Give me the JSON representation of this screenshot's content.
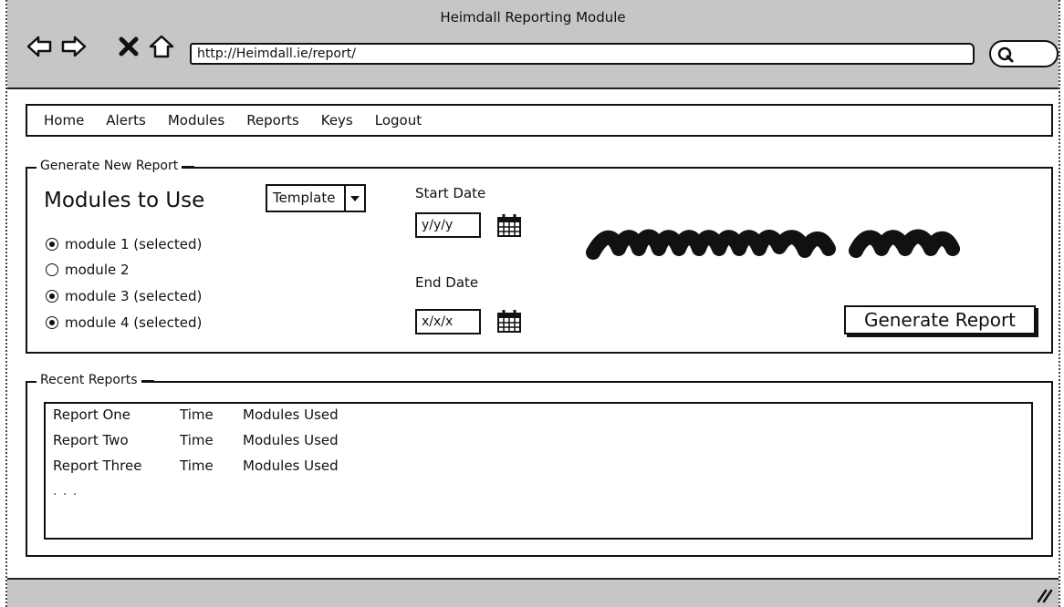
{
  "window": {
    "title": "Heimdall Reporting Module",
    "url": "http://Heimdall.ie/report/"
  },
  "icons": {
    "back": "arrow-left-icon",
    "forward": "arrow-right-icon",
    "stop": "close-icon",
    "home": "home-icon",
    "search": "search-icon",
    "calendar": "calendar-icon",
    "dropdown": "chevron-down-icon",
    "resize": "resize-grip-icon"
  },
  "menu": {
    "items": [
      "Home",
      "Alerts",
      "Modules",
      "Reports",
      "Keys",
      "Logout"
    ]
  },
  "generate": {
    "legend": "Generate New Report",
    "heading": "Modules to Use",
    "modules": [
      {
        "label": "module 1 (selected)",
        "selected": true
      },
      {
        "label": "module 2",
        "selected": false
      },
      {
        "label": "module 3 (selected)",
        "selected": true
      },
      {
        "label": "module 4 (selected)",
        "selected": true
      }
    ],
    "template_select": "Template",
    "start_label": "Start Date",
    "start_value": "y/y/y",
    "end_label": "End Date",
    "end_value": "x/x/x",
    "button": "Generate Report"
  },
  "recent": {
    "legend": "Recent Reports",
    "rows": [
      {
        "name": "Report One",
        "time": "Time",
        "modules": "Modules Used"
      },
      {
        "name": "Report Two",
        "time": "Time",
        "modules": "Modules Used"
      },
      {
        "name": "Report Three",
        "time": "Time",
        "modules": "Modules Used"
      }
    ],
    "more": ". . ."
  }
}
